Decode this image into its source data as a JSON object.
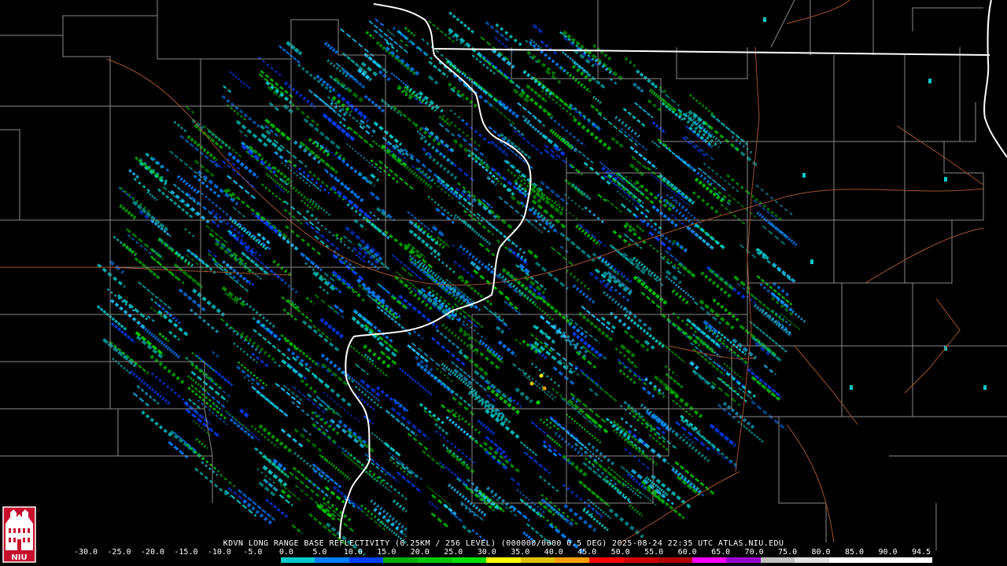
{
  "caption": "KDVN LONG RANGE BASE REFLECTIVITY (0.25KM / 256 LEVEL) (000000/0000 0.5 DEG) 2025-08-24 22:35 UTC  ATLAS.NIU.EDU",
  "logo_text": "NIU",
  "colors": {
    "background": "#000000",
    "county_lines": "#8a8a8a",
    "state_lines": "#ffffff",
    "roads": "#a0522d",
    "logo_red": "#c8102e"
  },
  "scale": {
    "labels": [
      "-30.0",
      "-25.0",
      "-20.0",
      "-15.0",
      "-10.0",
      "-5.0",
      "0.0",
      "5.0",
      "10.0",
      "15.0",
      "20.0",
      "25.0",
      "30.0",
      "35.0",
      "40.0",
      "45.0",
      "50.0",
      "55.0",
      "60.0",
      "65.0",
      "70.0",
      "75.0",
      "80.0",
      "85.0",
      "90.0",
      "94.5"
    ],
    "colors": [
      "#000000",
      "#000000",
      "#000000",
      "#000000",
      "#000000",
      "#000000",
      "#00c8c8",
      "#0080ff",
      "#0040ff",
      "#00b000",
      "#00c800",
      "#00e000",
      "#ffff00",
      "#e0c000",
      "#ffa000",
      "#ff0000",
      "#d00000",
      "#b00000",
      "#ff00ff",
      "#9900cc",
      "#c0c0c0",
      "#e0e0e0",
      "#ffffff",
      "#ffffff",
      "#ffffff"
    ]
  }
}
